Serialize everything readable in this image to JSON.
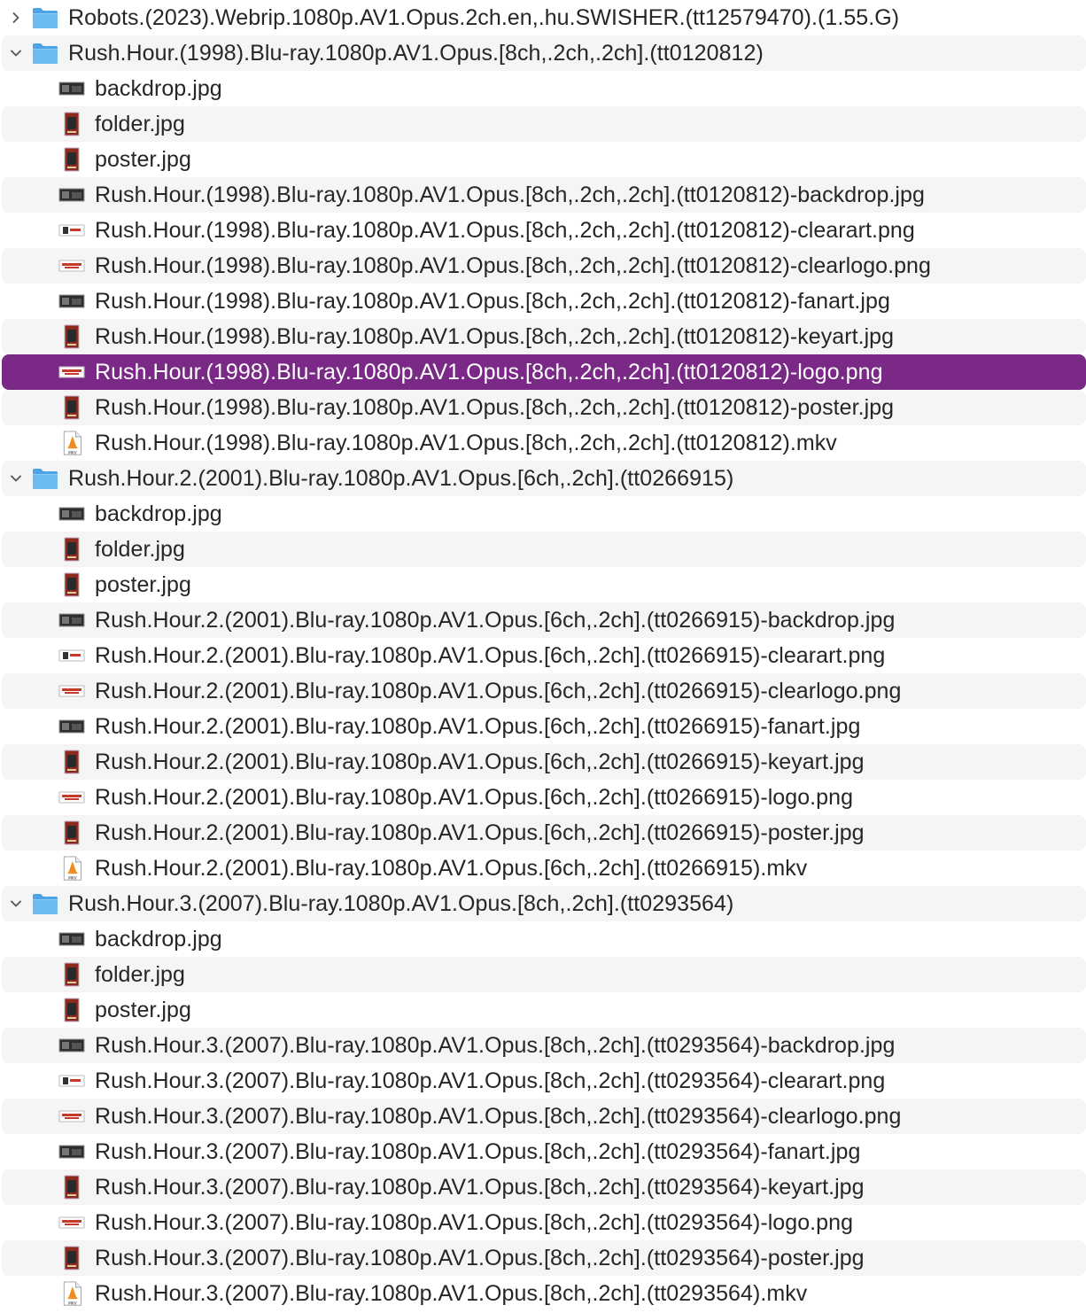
{
  "window": {
    "title": "Finder list view"
  },
  "colors": {
    "selection": "#7a2a86",
    "alt_row": "#f5f5f5",
    "folder_blue": "#5aaeea",
    "text": "#262626"
  },
  "rows": [
    {
      "kind": "folder",
      "expanded": false,
      "icon": "folder-icon",
      "name": "Robots.(2023).Webrip.1080p.AV1.Opus.2ch.en,.hu.SWISHER.(tt12579470).(1.55.G)"
    },
    {
      "kind": "folder",
      "expanded": true,
      "icon": "folder-icon",
      "name": "Rush.Hour.(1998).Blu-ray.1080p.AV1.Opus.[8ch,.2ch,.2ch].(tt0120812)"
    },
    {
      "kind": "file",
      "icon": "landscape-thumb-icon",
      "name": "backdrop.jpg"
    },
    {
      "kind": "file",
      "icon": "poster-thumb-icon",
      "name": "folder.jpg"
    },
    {
      "kind": "file",
      "icon": "poster-thumb-icon",
      "name": "poster.jpg"
    },
    {
      "kind": "file",
      "icon": "landscape-thumb-icon",
      "name": "Rush.Hour.(1998).Blu-ray.1080p.AV1.Opus.[8ch,.2ch,.2ch].(tt0120812)-backdrop.jpg"
    },
    {
      "kind": "file",
      "icon": "clearart-thumb-icon",
      "name": "Rush.Hour.(1998).Blu-ray.1080p.AV1.Opus.[8ch,.2ch,.2ch].(tt0120812)-clearart.png"
    },
    {
      "kind": "file",
      "icon": "logo-thumb-icon",
      "name": "Rush.Hour.(1998).Blu-ray.1080p.AV1.Opus.[8ch,.2ch,.2ch].(tt0120812)-clearlogo.png"
    },
    {
      "kind": "file",
      "icon": "landscape-thumb-icon",
      "name": "Rush.Hour.(1998).Blu-ray.1080p.AV1.Opus.[8ch,.2ch,.2ch].(tt0120812)-fanart.jpg"
    },
    {
      "kind": "file",
      "icon": "poster-thumb-icon",
      "name": "Rush.Hour.(1998).Blu-ray.1080p.AV1.Opus.[8ch,.2ch,.2ch].(tt0120812)-keyart.jpg"
    },
    {
      "kind": "file",
      "icon": "logo-thumb-icon",
      "selected": true,
      "name": "Rush.Hour.(1998).Blu-ray.1080p.AV1.Opus.[8ch,.2ch,.2ch].(tt0120812)-logo.png"
    },
    {
      "kind": "file",
      "icon": "poster-thumb-icon",
      "name": "Rush.Hour.(1998).Blu-ray.1080p.AV1.Opus.[8ch,.2ch,.2ch].(tt0120812)-poster.jpg"
    },
    {
      "kind": "file",
      "icon": "mkv-document-icon",
      "name": "Rush.Hour.(1998).Blu-ray.1080p.AV1.Opus.[8ch,.2ch,.2ch].(tt0120812).mkv"
    },
    {
      "kind": "folder",
      "expanded": true,
      "icon": "folder-icon",
      "name": "Rush.Hour.2.(2001).Blu-ray.1080p.AV1.Opus.[6ch,.2ch].(tt0266915)"
    },
    {
      "kind": "file",
      "icon": "landscape-thumb-icon",
      "name": "backdrop.jpg"
    },
    {
      "kind": "file",
      "icon": "poster-thumb-icon",
      "name": "folder.jpg"
    },
    {
      "kind": "file",
      "icon": "poster-thumb-icon",
      "name": "poster.jpg"
    },
    {
      "kind": "file",
      "icon": "landscape-thumb-icon",
      "name": "Rush.Hour.2.(2001).Blu-ray.1080p.AV1.Opus.[6ch,.2ch].(tt0266915)-backdrop.jpg"
    },
    {
      "kind": "file",
      "icon": "clearart-thumb-icon",
      "name": "Rush.Hour.2.(2001).Blu-ray.1080p.AV1.Opus.[6ch,.2ch].(tt0266915)-clearart.png"
    },
    {
      "kind": "file",
      "icon": "logo-thumb-icon",
      "name": "Rush.Hour.2.(2001).Blu-ray.1080p.AV1.Opus.[6ch,.2ch].(tt0266915)-clearlogo.png"
    },
    {
      "kind": "file",
      "icon": "landscape-thumb-icon",
      "name": "Rush.Hour.2.(2001).Blu-ray.1080p.AV1.Opus.[6ch,.2ch].(tt0266915)-fanart.jpg"
    },
    {
      "kind": "file",
      "icon": "poster-thumb-icon",
      "name": "Rush.Hour.2.(2001).Blu-ray.1080p.AV1.Opus.[6ch,.2ch].(tt0266915)-keyart.jpg"
    },
    {
      "kind": "file",
      "icon": "logo-thumb-icon",
      "name": "Rush.Hour.2.(2001).Blu-ray.1080p.AV1.Opus.[6ch,.2ch].(tt0266915)-logo.png"
    },
    {
      "kind": "file",
      "icon": "poster-thumb-icon",
      "name": "Rush.Hour.2.(2001).Blu-ray.1080p.AV1.Opus.[6ch,.2ch].(tt0266915)-poster.jpg"
    },
    {
      "kind": "file",
      "icon": "mkv-document-icon",
      "name": "Rush.Hour.2.(2001).Blu-ray.1080p.AV1.Opus.[6ch,.2ch].(tt0266915).mkv"
    },
    {
      "kind": "folder",
      "expanded": true,
      "icon": "folder-icon",
      "name": "Rush.Hour.3.(2007).Blu-ray.1080p.AV1.Opus.[8ch,.2ch].(tt0293564)"
    },
    {
      "kind": "file",
      "icon": "landscape-thumb-icon",
      "name": "backdrop.jpg"
    },
    {
      "kind": "file",
      "icon": "poster-thumb-icon",
      "name": "folder.jpg"
    },
    {
      "kind": "file",
      "icon": "poster-thumb-icon",
      "name": "poster.jpg"
    },
    {
      "kind": "file",
      "icon": "landscape-thumb-icon",
      "name": "Rush.Hour.3.(2007).Blu-ray.1080p.AV1.Opus.[8ch,.2ch].(tt0293564)-backdrop.jpg"
    },
    {
      "kind": "file",
      "icon": "clearart-thumb-icon",
      "name": "Rush.Hour.3.(2007).Blu-ray.1080p.AV1.Opus.[8ch,.2ch].(tt0293564)-clearart.png"
    },
    {
      "kind": "file",
      "icon": "logo-thumb-icon",
      "name": "Rush.Hour.3.(2007).Blu-ray.1080p.AV1.Opus.[8ch,.2ch].(tt0293564)-clearlogo.png"
    },
    {
      "kind": "file",
      "icon": "landscape-thumb-icon",
      "name": "Rush.Hour.3.(2007).Blu-ray.1080p.AV1.Opus.[8ch,.2ch].(tt0293564)-fanart.jpg"
    },
    {
      "kind": "file",
      "icon": "poster-thumb-icon",
      "name": "Rush.Hour.3.(2007).Blu-ray.1080p.AV1.Opus.[8ch,.2ch].(tt0293564)-keyart.jpg"
    },
    {
      "kind": "file",
      "icon": "logo-thumb-icon",
      "name": "Rush.Hour.3.(2007).Blu-ray.1080p.AV1.Opus.[8ch,.2ch].(tt0293564)-logo.png"
    },
    {
      "kind": "file",
      "icon": "poster-thumb-icon",
      "name": "Rush.Hour.3.(2007).Blu-ray.1080p.AV1.Opus.[8ch,.2ch].(tt0293564)-poster.jpg"
    },
    {
      "kind": "file",
      "icon": "mkv-document-icon",
      "name": "Rush.Hour.3.(2007).Blu-ray.1080p.AV1.Opus.[8ch,.2ch].(tt0293564).mkv"
    }
  ]
}
